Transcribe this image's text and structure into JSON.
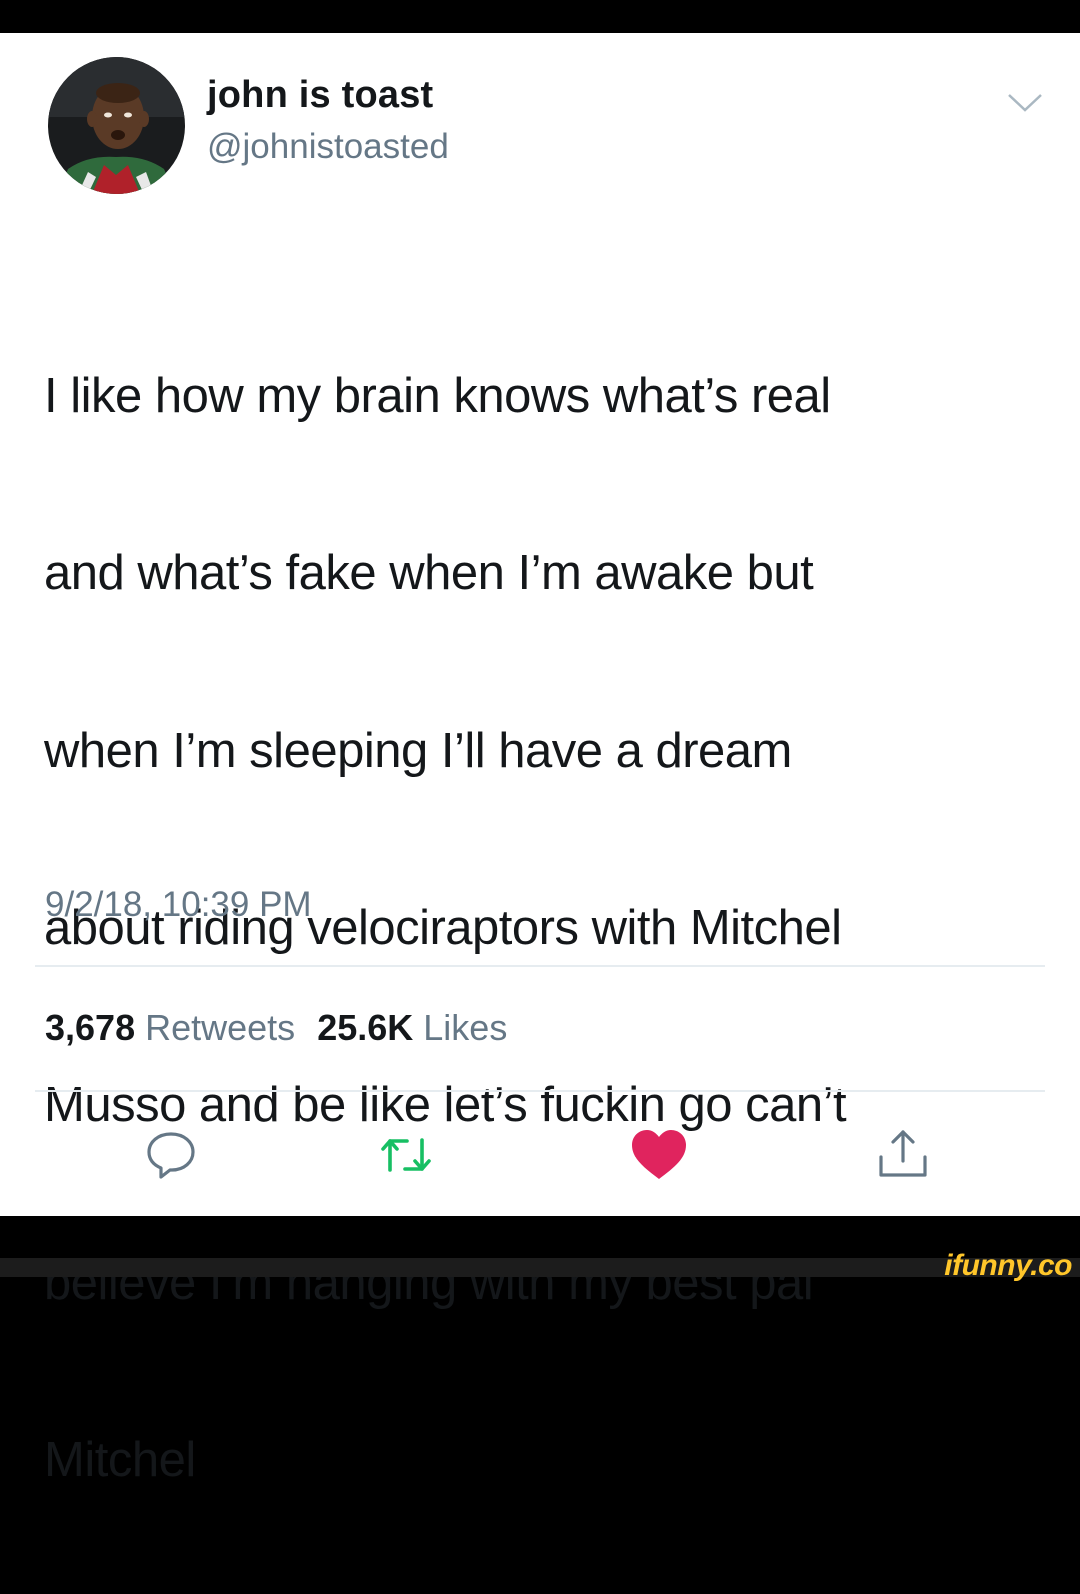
{
  "user": {
    "display_name": "john is toast",
    "handle": "@johnistoasted",
    "avatar_icon": "profile-photo"
  },
  "tweet": {
    "lines": [
      "I like how my brain knows what’s real",
      "and what’s fake when I’m awake but",
      "when I’m sleeping I’ll have a dream",
      "about riding velociraptors with Mitchel",
      "Musso and be like let’s fuckin go can’t",
      "believe I’m hanging with my best pal",
      "Mitchel"
    ],
    "timestamp": "9/2/18, 10:39 PM"
  },
  "stats": {
    "retweets_count": "3,678",
    "retweets_label": "Retweets",
    "likes_count": "25.6K",
    "likes_label": "Likes"
  },
  "actions": {
    "reply_icon": "reply-icon",
    "retweet_icon": "retweet-icon",
    "like_icon": "heart-icon",
    "share_icon": "share-icon"
  },
  "colors": {
    "retweet_green": "#17bf63",
    "like_red": "#e0245e",
    "icon_gray": "#657786",
    "watermark": "#ffc62a"
  },
  "watermark": "ifunny.co"
}
